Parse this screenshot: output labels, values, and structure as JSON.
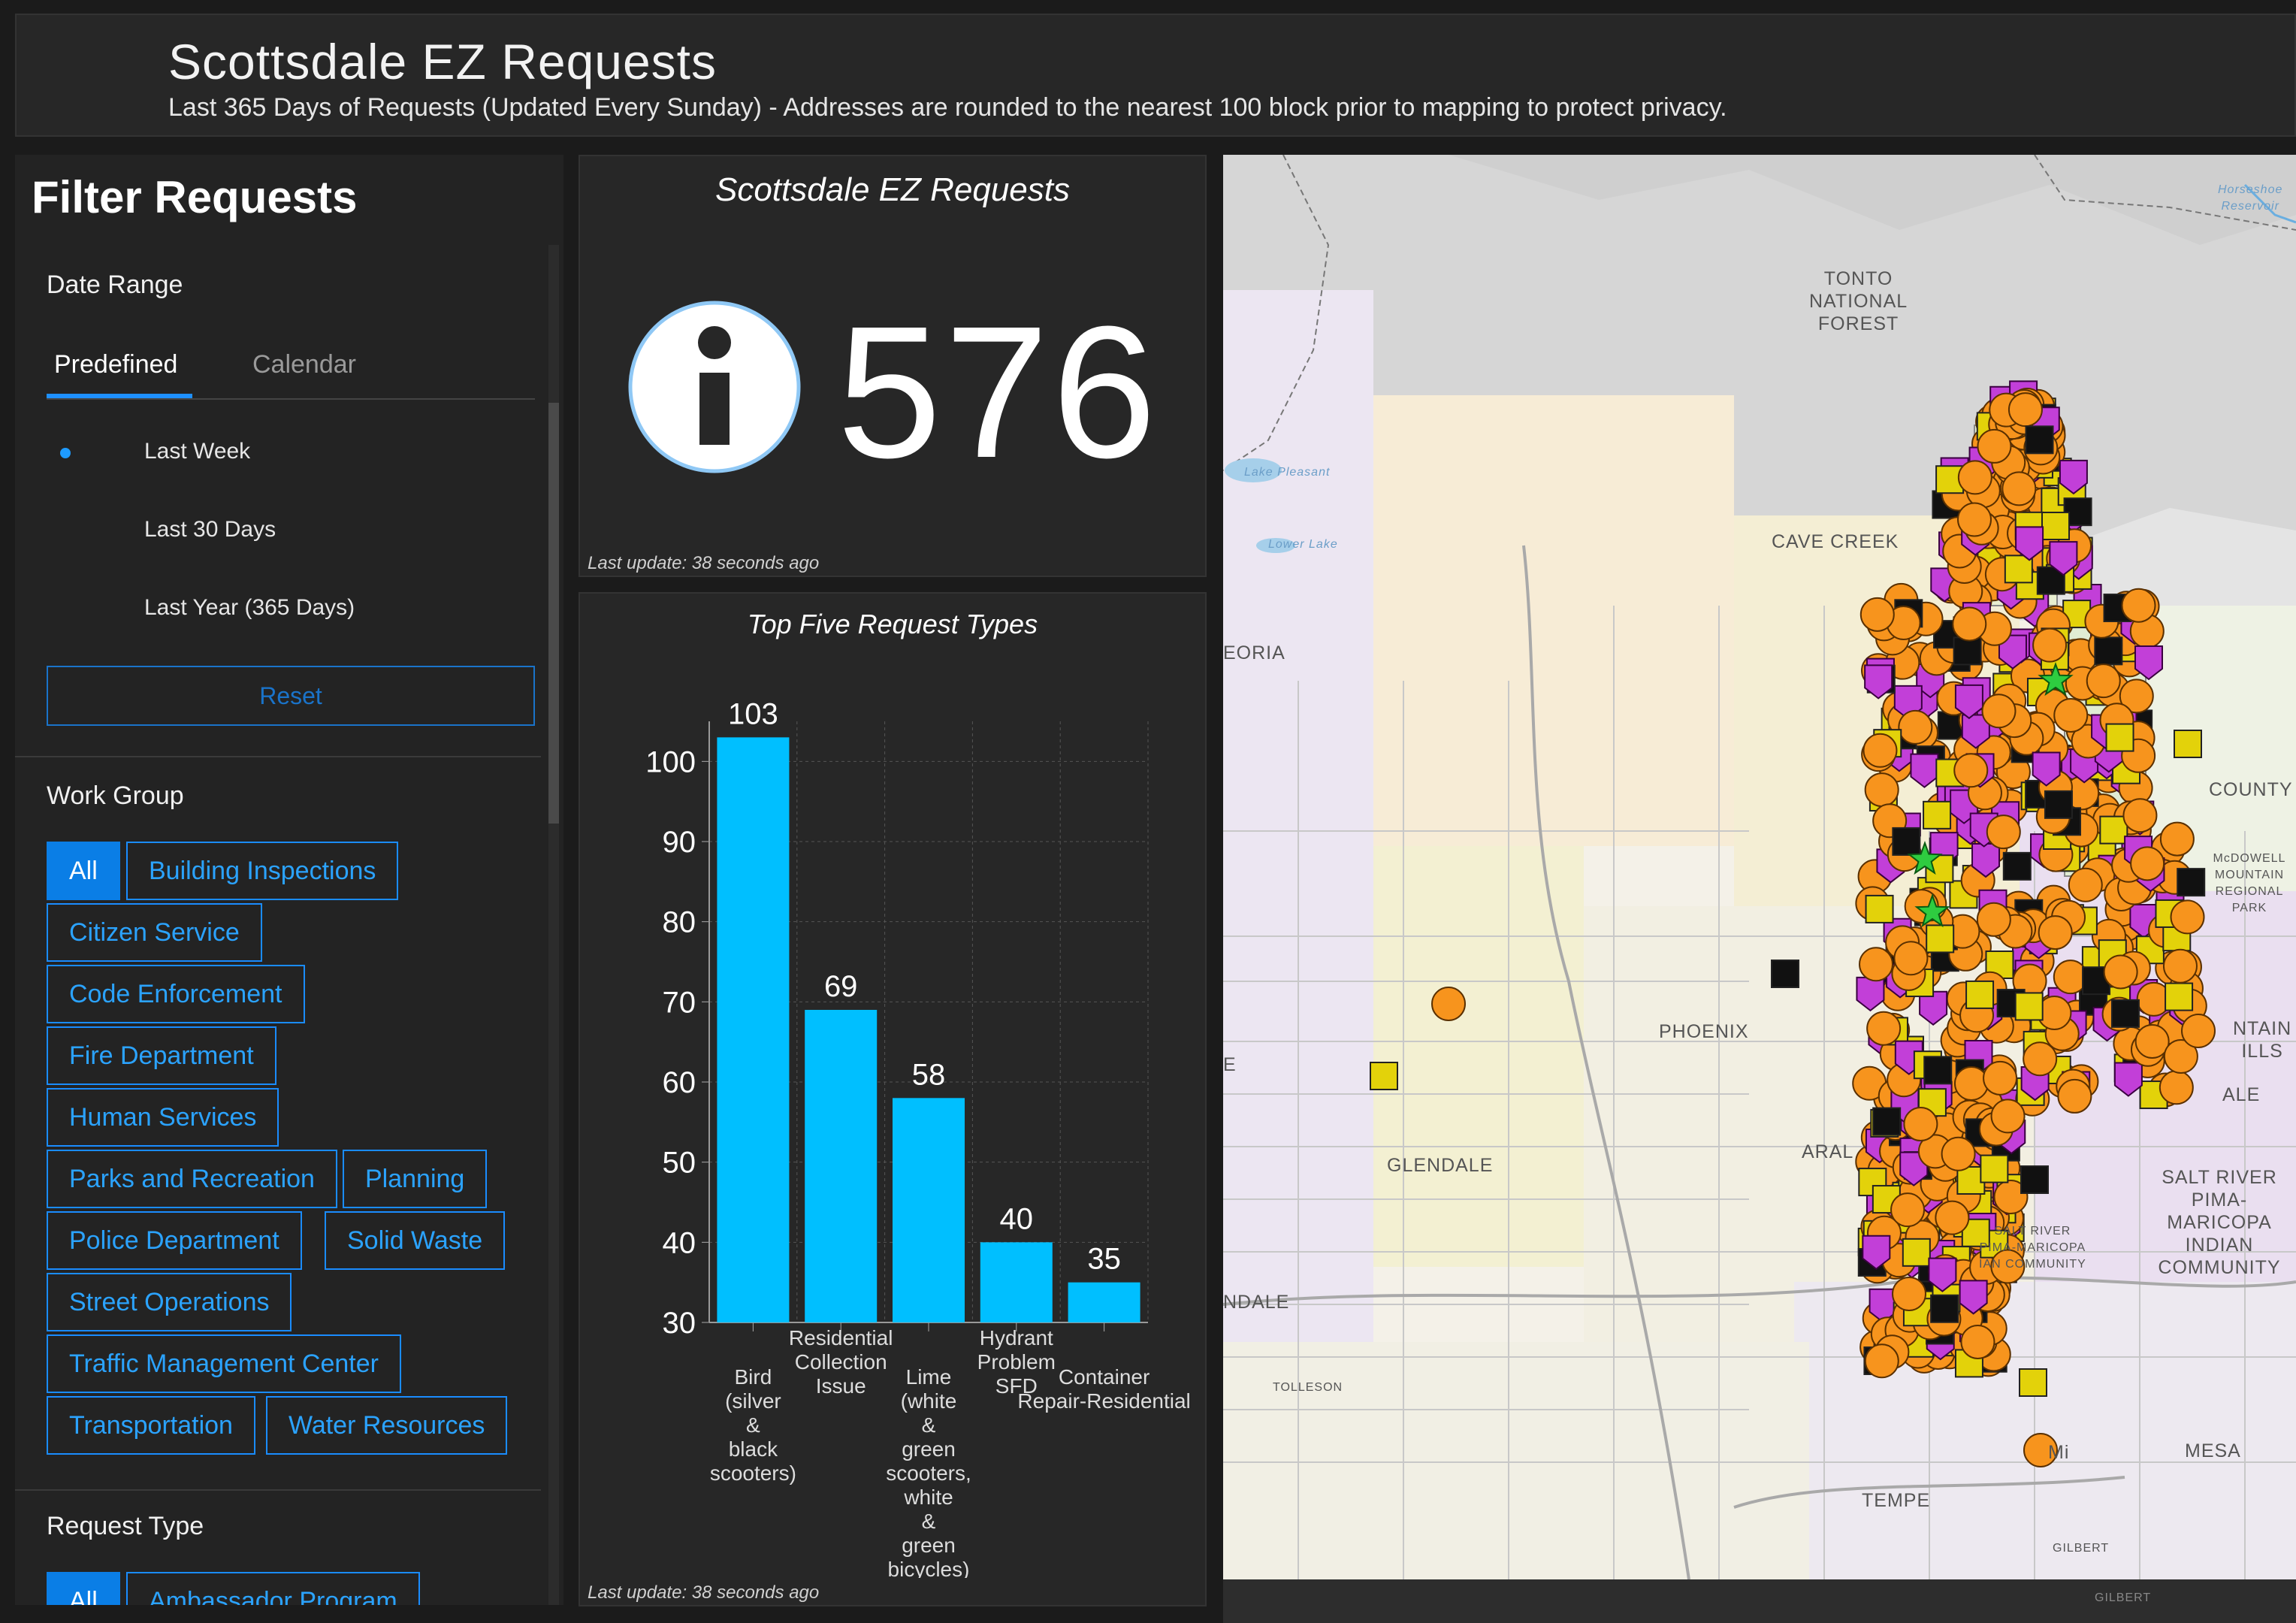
{
  "header": {
    "title": "Scottsdale EZ Requests",
    "subtitle": "Last 365 Days of Requests (Updated Every Sunday) - Addresses are rounded to the nearest 100 block prior to mapping to protect privacy."
  },
  "filter": {
    "title": "Filter Requests",
    "date_range": {
      "label": "Date Range",
      "tabs": [
        "Predefined",
        "Calendar"
      ],
      "options": [
        "Last Week",
        "Last 30 Days",
        "Last Year (365 Days)"
      ],
      "selected": "Last Week",
      "reset_label": "Reset"
    },
    "work_group": {
      "label": "Work Group",
      "chips": [
        "All",
        "Building Inspections",
        "Citizen Service",
        "Code Enforcement",
        "Fire Department",
        "Human Services",
        "Parks and Recreation",
        "Planning",
        "Police Department",
        "Solid Waste",
        "Street Operations",
        "Traffic Management Center",
        "Transportation",
        "Water Resources"
      ]
    },
    "request_type": {
      "label": "Request Type",
      "chips": [
        "All",
        "Ambassador Program"
      ]
    }
  },
  "indicator": {
    "title": "Scottsdale EZ Requests",
    "value": "576",
    "icon": "info-icon",
    "last_update": "Last update: 38 seconds ago"
  },
  "chart_panel": {
    "title": "Top Five Request Types",
    "last_update": "Last update: 38 seconds ago"
  },
  "chart_data": {
    "type": "bar",
    "title": "Top Five Request Types",
    "categories": [
      [
        "Bird",
        "(silver",
        "&",
        "black",
        "scooters)"
      ],
      [
        "Residential",
        "Collection",
        "Issue"
      ],
      [
        "Lime",
        "(white",
        "&",
        "green",
        "scooters,",
        "white",
        "&",
        "green",
        "bicycles)"
      ],
      [
        "Hydrant",
        "Problem",
        "SFD"
      ],
      [
        "Container",
        "Repair-Residential"
      ]
    ],
    "values": [
      103,
      69,
      58,
      40,
      35
    ],
    "ylim": [
      30,
      105
    ],
    "yticks": [
      30,
      40,
      50,
      60,
      70,
      80,
      90,
      100
    ],
    "grid": true,
    "bar_color": "#00bfff"
  },
  "map": {
    "labels": [
      "TONTO\nNATIONAL\nFOREST",
      "CAVE CREEK",
      "PHOENIX",
      "GLENDALE",
      "COUNTY",
      "McDOWELL\nMOUNTAIN\nREGIONAL PARK",
      "SALT RIVER\nPIMA-MARICOPA\nINDIAN COMMUNITY",
      "MESA",
      "TEMPE",
      "TOLLESON",
      "EORIA",
      "NTAIN\nILLS",
      "ALE",
      "NDALE",
      "ARAL",
      "Lake Pleasant",
      "Lower Lake",
      "Horseshoe\nReservoir",
      "SALT RIVER\nPIMA-MARICOPA\nIAN COMMUNITY",
      "GILBERT",
      "Mi"
    ],
    "marker_colors": {
      "orange": "#f7941d",
      "yellow": "#e3d20a",
      "purple": "#c23fd8",
      "black": "#111111",
      "green": "#2ecc40"
    }
  }
}
